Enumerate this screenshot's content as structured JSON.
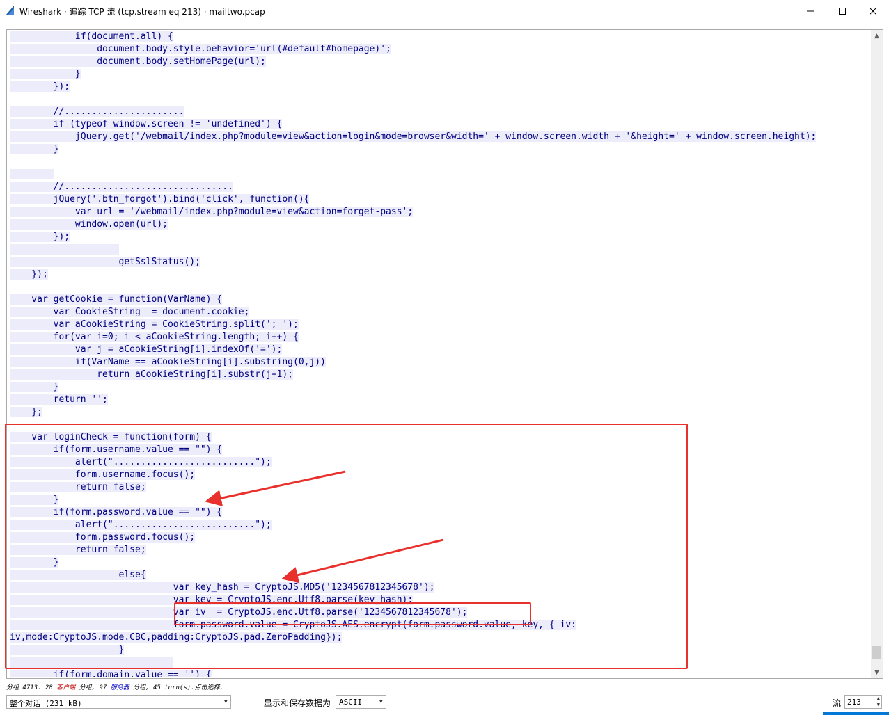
{
  "window": {
    "title": "Wireshark · 追踪 TCP 流 (tcp.stream eq 213) · mailtwo.pcap",
    "icon": "wireshark-fin-icon",
    "controls": {
      "minimize": "—",
      "maximize": "☐",
      "close": "✕"
    }
  },
  "stream": {
    "lines": [
      "            if(document.all) {",
      "                document.body.style.behavior='url(#default#homepage)';",
      "                document.body.setHomePage(url);",
      "            }",
      "        });",
      "",
      "        //......................",
      "        if (typeof window.screen != 'undefined') {",
      "            jQuery.get('/webmail/index.php?module=view&action=login&mode=browser&width=' + window.screen.width + '&height=' + window.screen.height);",
      "        }",
      "",
      "        ",
      "        //...............................",
      "        jQuery('.btn_forgot').bind('click', function(){",
      "            var url = '/webmail/index.php?module=view&action=forget-pass';",
      "            window.open(url);",
      "        });",
      "                    ",
      "                    getSslStatus();",
      "    });",
      "",
      "    var getCookie = function(VarName) {",
      "        var CookieString  = document.cookie;",
      "        var aCookieString = CookieString.split('; ');",
      "        for(var i=0; i < aCookieString.length; i++) {",
      "            var j = aCookieString[i].indexOf('=');",
      "            if(VarName == aCookieString[i].substring(0,j))",
      "                return aCookieString[i].substr(j+1);",
      "        }",
      "        return '';",
      "    };",
      "",
      "    var loginCheck = function(form) {",
      "        if(form.username.value == \"\") {",
      "            alert(\"..........................\");",
      "            form.username.focus();",
      "            return false;",
      "        }",
      "        if(form.password.value == \"\") {",
      "            alert(\"..........................\");",
      "            form.password.focus();",
      "            return false;",
      "        }",
      "                    else{",
      "                              var key_hash = CryptoJS.MD5('1234567812345678');",
      "                              var key = CryptoJS.enc.Utf8.parse(key_hash);",
      "                              var iv  = CryptoJS.enc.Utf8.parse('1234567812345678');",
      "                              form.password.value = CryptoJS.AES.encrypt(form.password.value, key, { iv:",
      "iv,mode:CryptoJS.mode.CBC,padding:CryptoJS.pad.ZeroPadding});",
      "                    }",
      "                              ",
      "        if(form.domain.value == '') {"
    ],
    "highlight_color": "#ececfa",
    "text_color": "#000080"
  },
  "status": {
    "part1": "分组 4713. 28 ",
    "client_label": "客户端",
    "part2": " 分组, 97 ",
    "server_label": "服务器",
    "part3": " 分组, 45 turn(s).点击选择."
  },
  "controls": {
    "conversation_value": "整个对话 (231 kB)",
    "show_save_label": "显示和保存数据为",
    "encoding_value": "ASCII",
    "stream_label": "流",
    "stream_value": "213"
  },
  "annotation": {
    "color": "#e8302d"
  }
}
